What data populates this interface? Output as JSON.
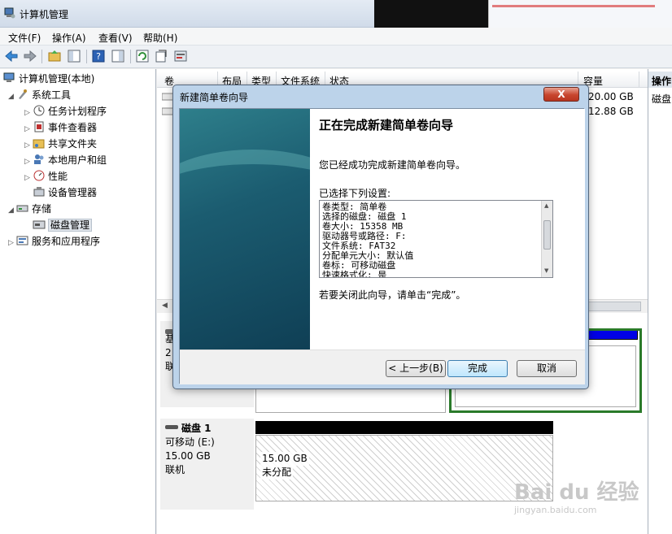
{
  "window": {
    "title": "计算机管理"
  },
  "menu": [
    "文件(F)",
    "操作(A)",
    "查看(V)",
    "帮助(H)"
  ],
  "tree": {
    "root": "计算机管理(本地)",
    "system_tools": "系统工具",
    "task_scheduler": "任务计划程序",
    "event_viewer": "事件查看器",
    "shared_folders": "共享文件夹",
    "local_users": "本地用户和组",
    "performance": "性能",
    "device_manager": "设备管理器",
    "storage": "存储",
    "disk_management": "磁盘管理",
    "services": "服务和应用程序"
  },
  "columns": {
    "volume": "卷",
    "layout": "布局",
    "type": "类型",
    "fs": "文件系统",
    "status": "状态",
    "capacity": "容量"
  },
  "volumes": [
    {
      "capacity": "20.00 GB"
    },
    {
      "capacity": "12.88 GB"
    }
  ],
  "actions": {
    "header": "操作",
    "item": "磁盘"
  },
  "disk0": {
    "line1": "基",
    "line2": "2",
    "line3": "联"
  },
  "disk1": {
    "name": "磁盘 1",
    "type": "可移动 (E:)",
    "size": "15.00 GB",
    "state": "联机",
    "part_size": "15.00 GB",
    "part_state": "未分配"
  },
  "dialog": {
    "title": "新建简单卷向导",
    "close": "X",
    "heading": "正在完成新建简单卷向导",
    "success": "您已经成功完成新建简单卷向导。",
    "selected_label": "已选择下列设置:",
    "settings": [
      "卷类型: 简单卷",
      "选择的磁盘: 磁盘 1",
      "卷大小: 15358 MB",
      "驱动器号或路径: F:",
      "文件系统: FAT32",
      "分配单元大小: 默认值",
      "卷标: 可移动磁盘",
      "快速格式化: 是"
    ],
    "close_hint": "若要关闭此向导，请单击“完成”。",
    "back": "< 上一步(B)",
    "finish": "完成",
    "cancel": "取消"
  },
  "watermark": {
    "brand": "Bai du 经验",
    "url": "jingyan.baidu.com"
  }
}
